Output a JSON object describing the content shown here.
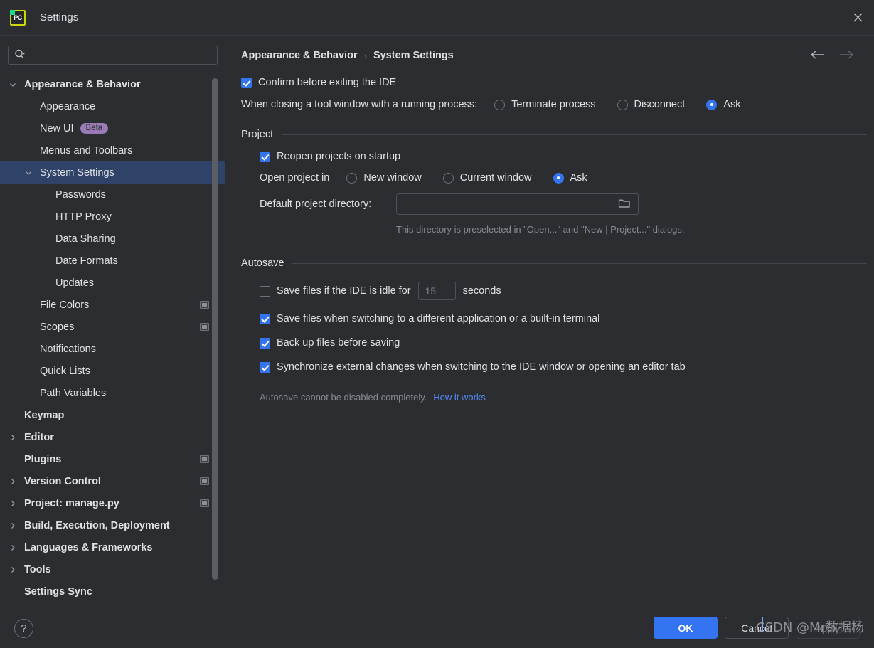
{
  "window": {
    "title": "Settings",
    "app_icon": "pycharm-icon",
    "app_icon_text": "PC",
    "close_icon": "close-icon"
  },
  "search": {
    "value": "",
    "placeholder": "",
    "icon": "search-icon"
  },
  "sidebar": {
    "items": [
      {
        "label": "Appearance & Behavior",
        "indent": 0,
        "bold": true,
        "arrow": "chevron-down",
        "selected": false,
        "badge": null,
        "project_badge": false
      },
      {
        "label": "Appearance",
        "indent": 1,
        "bold": false,
        "arrow": "none",
        "selected": false,
        "badge": null,
        "project_badge": false
      },
      {
        "label": "New UI",
        "indent": 1,
        "bold": false,
        "arrow": "none",
        "selected": false,
        "badge": "Beta",
        "project_badge": false
      },
      {
        "label": "Menus and Toolbars",
        "indent": 1,
        "bold": false,
        "arrow": "none",
        "selected": false,
        "badge": null,
        "project_badge": false
      },
      {
        "label": "System Settings",
        "indent": 1,
        "bold": false,
        "arrow": "chevron-down",
        "selected": true,
        "badge": null,
        "project_badge": false
      },
      {
        "label": "Passwords",
        "indent": 2,
        "bold": false,
        "arrow": "none",
        "selected": false,
        "badge": null,
        "project_badge": false
      },
      {
        "label": "HTTP Proxy",
        "indent": 2,
        "bold": false,
        "arrow": "none",
        "selected": false,
        "badge": null,
        "project_badge": false
      },
      {
        "label": "Data Sharing",
        "indent": 2,
        "bold": false,
        "arrow": "none",
        "selected": false,
        "badge": null,
        "project_badge": false
      },
      {
        "label": "Date Formats",
        "indent": 2,
        "bold": false,
        "arrow": "none",
        "selected": false,
        "badge": null,
        "project_badge": false
      },
      {
        "label": "Updates",
        "indent": 2,
        "bold": false,
        "arrow": "none",
        "selected": false,
        "badge": null,
        "project_badge": false
      },
      {
        "label": "File Colors",
        "indent": 1,
        "bold": false,
        "arrow": "none",
        "selected": false,
        "badge": null,
        "project_badge": true
      },
      {
        "label": "Scopes",
        "indent": 1,
        "bold": false,
        "arrow": "none",
        "selected": false,
        "badge": null,
        "project_badge": true
      },
      {
        "label": "Notifications",
        "indent": 1,
        "bold": false,
        "arrow": "none",
        "selected": false,
        "badge": null,
        "project_badge": false
      },
      {
        "label": "Quick Lists",
        "indent": 1,
        "bold": false,
        "arrow": "none",
        "selected": false,
        "badge": null,
        "project_badge": false
      },
      {
        "label": "Path Variables",
        "indent": 1,
        "bold": false,
        "arrow": "none",
        "selected": false,
        "badge": null,
        "project_badge": false
      },
      {
        "label": "Keymap",
        "indent": 0,
        "bold": true,
        "arrow": "none",
        "selected": false,
        "badge": null,
        "project_badge": false
      },
      {
        "label": "Editor",
        "indent": 0,
        "bold": true,
        "arrow": "chevron-right",
        "selected": false,
        "badge": null,
        "project_badge": false
      },
      {
        "label": "Plugins",
        "indent": 0,
        "bold": true,
        "arrow": "none",
        "selected": false,
        "badge": null,
        "project_badge": true
      },
      {
        "label": "Version Control",
        "indent": 0,
        "bold": true,
        "arrow": "chevron-right",
        "selected": false,
        "badge": null,
        "project_badge": true
      },
      {
        "label": "Project: manage.py",
        "indent": 0,
        "bold": true,
        "arrow": "chevron-right",
        "selected": false,
        "badge": null,
        "project_badge": true
      },
      {
        "label": "Build, Execution, Deployment",
        "indent": 0,
        "bold": true,
        "arrow": "chevron-right",
        "selected": false,
        "badge": null,
        "project_badge": false
      },
      {
        "label": "Languages & Frameworks",
        "indent": 0,
        "bold": true,
        "arrow": "chevron-right",
        "selected": false,
        "badge": null,
        "project_badge": false
      },
      {
        "label": "Tools",
        "indent": 0,
        "bold": true,
        "arrow": "chevron-right",
        "selected": false,
        "badge": null,
        "project_badge": false
      },
      {
        "label": "Settings Sync",
        "indent": 0,
        "bold": true,
        "arrow": "none",
        "selected": false,
        "badge": null,
        "project_badge": false
      }
    ]
  },
  "breadcrumb": {
    "parent": "Appearance & Behavior",
    "separator": "›",
    "current": "System Settings",
    "back_icon": "arrow-left-icon",
    "forward_icon": "arrow-right-icon"
  },
  "main": {
    "confirm_exit": {
      "label": "Confirm before exiting the IDE",
      "checked": true
    },
    "closing_tool_window": {
      "label": "When closing a tool window with a running process:",
      "options": [
        {
          "label": "Terminate process",
          "selected": false
        },
        {
          "label": "Disconnect",
          "selected": false
        },
        {
          "label": "Ask",
          "selected": true
        }
      ]
    },
    "project_section": {
      "title": "Project",
      "reopen": {
        "label": "Reopen projects on startup",
        "checked": true
      },
      "open_project_in": {
        "label": "Open project in",
        "options": [
          {
            "label": "New window",
            "selected": false
          },
          {
            "label": "Current window",
            "selected": false
          },
          {
            "label": "Ask",
            "selected": true
          }
        ]
      },
      "default_dir": {
        "label": "Default project directory:",
        "value": "",
        "browse_icon": "folder-icon"
      },
      "hint": "This directory is preselected in \"Open...\" and \"New | Project...\" dialogs."
    },
    "autosave_section": {
      "title": "Autosave",
      "idle_save": {
        "label": "Save files if the IDE is idle for",
        "checked": false,
        "seconds_value": "15",
        "seconds_label": "seconds"
      },
      "items": [
        {
          "label": "Save files when switching to a different application or a built-in terminal",
          "checked": true
        },
        {
          "label": "Back up files before saving",
          "checked": true
        },
        {
          "label": "Synchronize external changes when switching to the IDE window or opening an editor tab",
          "checked": true
        }
      ],
      "footer_text": "Autosave cannot be disabled completely.",
      "footer_link": "How it works"
    }
  },
  "footer": {
    "help_label": "?",
    "ok_label": "OK",
    "cancel_label": "Cancel",
    "apply_label": "Apply",
    "watermark": "CSDN @Mr数据杨"
  },
  "colors": {
    "accent": "#3574f0",
    "selection": "#2f4268",
    "background": "#2b2d30",
    "beta_badge": "#9a7bb5",
    "link": "#548af7"
  }
}
